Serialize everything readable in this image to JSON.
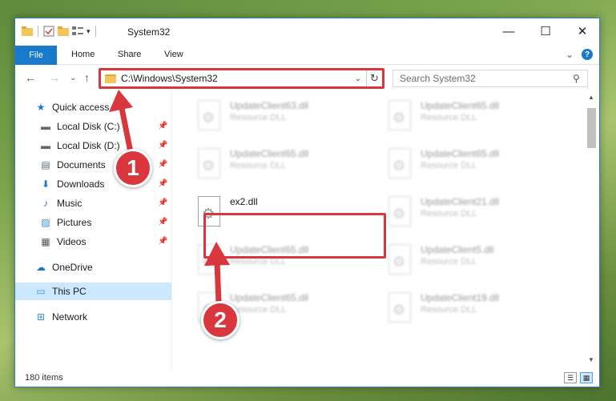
{
  "window": {
    "title": "System32",
    "minimize": "—",
    "maximize": "☐",
    "close": "✕"
  },
  "ribbon": {
    "file": "File",
    "home": "Home",
    "share": "Share",
    "view": "View",
    "expand": "⌄",
    "help": "?"
  },
  "nav": {
    "back": "←",
    "forward": "→",
    "recent": "⌄",
    "up": "↑",
    "address": "C:\\Windows\\System32",
    "address_chevron": "⌄",
    "refresh": "↻",
    "search_placeholder": "Search System32",
    "search_icon": "⚲"
  },
  "sidebar": {
    "quick_access": "Quick access",
    "items": [
      {
        "label": "Local Disk (C:)",
        "icon": "drive-icon",
        "glyph": "▬",
        "pinned": true
      },
      {
        "label": "Local Disk (D:)",
        "icon": "drive-icon",
        "glyph": "▬",
        "pinned": true
      },
      {
        "label": "Documents",
        "icon": "documents-icon",
        "glyph": "▤",
        "pinned": true
      },
      {
        "label": "Downloads",
        "icon": "downloads-icon",
        "glyph": "⬇",
        "pinned": true
      },
      {
        "label": "Music",
        "icon": "music-icon",
        "glyph": "♪",
        "pinned": true
      },
      {
        "label": "Pictures",
        "icon": "pictures-icon",
        "glyph": "▨",
        "pinned": true
      },
      {
        "label": "Videos",
        "icon": "videos-icon",
        "glyph": "▦",
        "pinned": true
      }
    ],
    "pin_glyph": "📌",
    "onedrive": "OneDrive",
    "this_pc": "This PC",
    "network": "Network"
  },
  "files": [
    {
      "name": "UpdateClient63.dll",
      "type": "Resource DLL"
    },
    {
      "name": "UpdateClient65.dll",
      "type": "Resource DLL"
    },
    {
      "name": "UpdateClient65.dll",
      "type": "Resource DLL"
    },
    {
      "name": "UpdateClient65.dll",
      "type": "Resource DLL"
    },
    {
      "name": "ex2.dll",
      "type": ""
    },
    {
      "name": "UpdateClient21.dll",
      "type": "Resource DLL"
    },
    {
      "name": "UpdateClient65.dll",
      "type": "Resource DLL"
    },
    {
      "name": "UpdateClient5.dll",
      "type": "Resource DLL"
    },
    {
      "name": "UpdateClient65.dll",
      "type": "Resource DLL"
    },
    {
      "name": "UpdateClient19.dll",
      "type": "Resource DLL"
    }
  ],
  "status": {
    "count": "180 items"
  },
  "callouts": {
    "one": "1",
    "two": "2"
  },
  "colors": {
    "accent": "#1979ca",
    "highlight": "#d9363e"
  }
}
